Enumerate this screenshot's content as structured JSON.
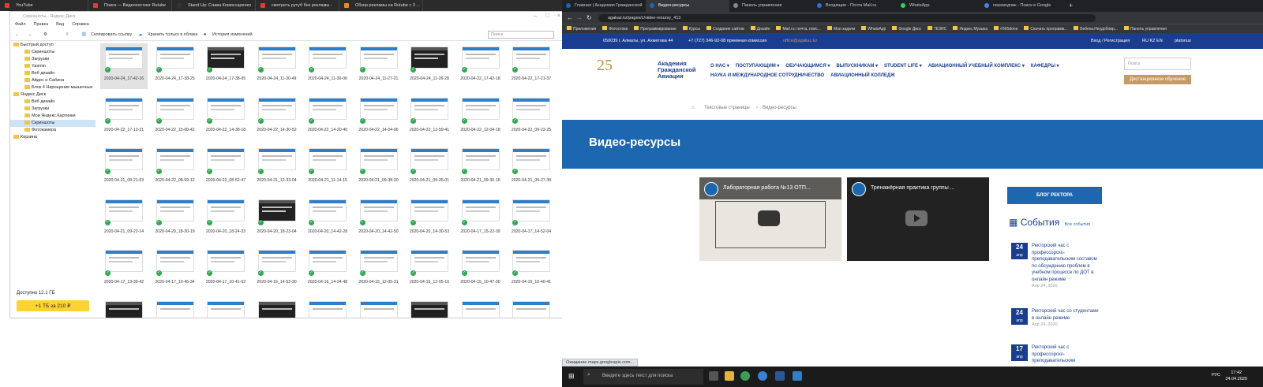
{
  "left_browser_tabs": [
    "YouTube",
    "Поиск — Видеохостинг Rutube",
    "Stand Up: Слава Комиссаренко",
    "смотреть рутуб без рекламы -",
    "Обзор рекламы на Rutube с 3 ..."
  ],
  "disk": {
    "title": "Скриншоты - Яндекс.Диск",
    "menu": [
      "Файл",
      "Правка",
      "Вид",
      "Справка"
    ],
    "toolbar": {
      "copy_link": "Скопировать ссылку",
      "cloud_only": "Хранить только в облаке",
      "history": "История изменений"
    },
    "search_placeholder": "Поиск",
    "sidebar": [
      {
        "label": "Быстрый доступ",
        "level": 0
      },
      {
        "label": "Скриншоты",
        "level": 1
      },
      {
        "label": "Загрузки",
        "level": 1
      },
      {
        "label": "Yasmin",
        "level": 1
      },
      {
        "label": "Веб дизайн",
        "level": 1
      },
      {
        "label": "Айдос и Сабина",
        "level": 1
      },
      {
        "label": "Блок 4 Нарощение мышечных",
        "level": 1
      },
      {
        "label": "Яндекс.Диск",
        "level": 0
      },
      {
        "label": "Веб дизайн",
        "level": 1
      },
      {
        "label": "Загрузки",
        "level": 1
      },
      {
        "label": "Мои Яндекс.Картинки",
        "level": 1
      },
      {
        "label": "Скриншоты",
        "level": 1,
        "selected": true
      },
      {
        "label": "Фотокамера",
        "level": 1
      },
      {
        "label": "Корзина",
        "level": 0
      }
    ],
    "free_space": "Доступно 12.1 ГБ",
    "buy_button": "+1 ТБ за 210 ₽",
    "files": [
      "2020-04-24_17-42-16",
      "2020-04-24_17-38-25",
      "2020-04-24_17-38-05",
      "2020-04-24_11-30-49",
      "2020-04-24_11-30-06",
      "2020-04-24_11-27-21",
      "2020-04-24_11-26-28",
      "2020-04-22_17-42-18",
      "2020-04-22_17-21-37",
      "2020-04-22_17-12-21",
      "2020-04-22_15-00-42",
      "2020-04-22_14-38-18",
      "2020-04-22_14-30-52",
      "2020-04-22_14-20-40",
      "2020-04-22_14-04-06",
      "2020-04-22_12-59-41",
      "2020-04-22_12-04-18",
      "2020-04-22_09-23-25",
      "2020-04-21_09-21-53",
      "2020-04-22_08-59-12",
      "2020-04-22_08-52-47",
      "2020-04-21_12-33-04",
      "2020-04-21_11-14-15",
      "2020-04-21_09-38-20",
      "2020-04-21_09-35-01",
      "2020-04-21_09-30-16",
      "2020-04-21_09-27-39",
      "2020-04-21_09-22-14",
      "2020-04-20_18-30-19",
      "2020-04-20_18-24-33",
      "2020-04-20_18-23-04",
      "2020-04-20_14-42-28",
      "2020-04-20_14-42-50",
      "2020-04-20_14-30-53",
      "2020-04-17_15-22-39",
      "2020-04-17_14-52-04",
      "2020-04-17_13-39-42",
      "2020-04-17_10-46-34",
      "2020-04-17_10-41-52",
      "2020-04-16_14-52-30",
      "2020-04-16_14-24-48",
      "2020-04-15_12-05-31",
      "2020-04-15_12-05-10",
      "2020-04-15_10-47-30",
      "2020-04-15_10-40-41"
    ]
  },
  "chrome": {
    "tabs": [
      "Главная | Академия Гражданской",
      "Видео-ресурсы",
      "Панель управления",
      "Входящие - Почта Mail.ru",
      "WhatsApp",
      "переводчик - Поиск в Google"
    ],
    "url": "agakaz.kz/pages/c/video-resursy_413",
    "bookmarks": [
      "Приложения",
      "Фотостоки",
      "Программирование",
      "Курсы",
      "Создание сайтов",
      "Дизайн",
      "Mail.ru: почта, поис...",
      "Мои задачи",
      "WhatsApp",
      "Google Диск",
      "ТЕЗИС",
      "Яндекс.Музыка",
      "#365done",
      "Скачать программ...",
      "Бебека.Неудобовр...",
      "Панель управления"
    ],
    "status": "Ожидание maps.googleapis.com..."
  },
  "site": {
    "address": "050039 г. Алматы, ул. Ахметова 44",
    "phone": "+7 (727) 346-92-08 приемная комиссия",
    "email": "office@agakaz.kz",
    "login": "Вход / Регистрация",
    "langs": "RU  KZ  EN",
    "platonus": "platonus",
    "logo_number": "25",
    "logo_text": "Академия Гражданской Авиации",
    "nav_row1": [
      "О НАС",
      "ПОСТУПАЮЩИМ",
      "ОБУЧАЮЩИМСЯ",
      "ВЫПУСКНИКАМ",
      "STUDENT LIFE",
      "АВИАЦИОННЫЙ УЧЕБНЫЙ КОМПЛЕКС",
      "КАФЕДРЫ"
    ],
    "nav_row2": [
      "НАУКА И МЕЖДУНАРОДНОЕ СОТРУДНИЧЕСТВО",
      "АВИАЦИОННЫЙ КОЛЛЕДЖ"
    ],
    "search_placeholder": "Поиск",
    "distance_button": "Дистанционное обучение",
    "breadcrumbs": [
      "Текстовые страницы",
      "Видео-ресурсы"
    ],
    "page_title": "Видео-ресурсы",
    "videos": [
      {
        "title": "Лабораторная работа №13 ОТП..."
      },
      {
        "title": "Тренажёрная практика группы ..."
      }
    ],
    "blog_button": "БЛОГ РЕКТОРА",
    "events_title": "События",
    "events_all": "Все события",
    "events": [
      {
        "day": "24",
        "month": "апр",
        "text": "Ректорский час с профессорско-преподавательским составом по обсуждению проблем в учебном процессе по ДОТ в онлайн режиме",
        "date": "Апр 24, 2020"
      },
      {
        "day": "24",
        "month": "апр",
        "text": "Ректорский час со студентами в онлайн режиме",
        "date": "Апр 24, 2020"
      },
      {
        "day": "17",
        "month": "апр",
        "text": "Ректорский час с профессорско-преподавательским",
        "date": ""
      }
    ]
  },
  "taskbar": {
    "search": "Введите здесь текст для поиска",
    "lang": "РУС",
    "time": "17:42",
    "date": "24.04.2020"
  }
}
